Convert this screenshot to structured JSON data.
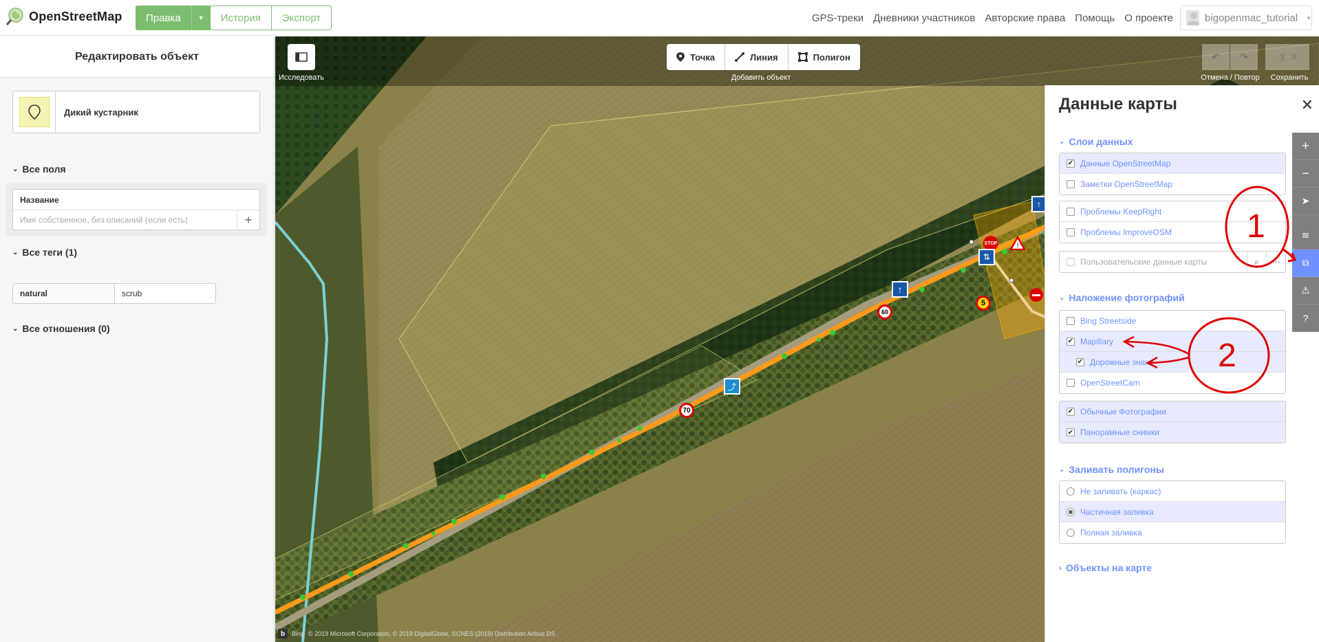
{
  "header": {
    "logo_text": "OpenStreetMap",
    "edit_label": "Правка",
    "history_label": "История",
    "export_label": "Экспорт",
    "nav": [
      "GPS-треки",
      "Дневники участников",
      "Авторские права",
      "Помощь",
      "О проекте"
    ],
    "username": "bigopenmac_tutorial"
  },
  "sidebar": {
    "title": "Редактировать объект",
    "preset_name": "Дикий кустарник",
    "all_fields_title": "Все поля",
    "name_field_label": "Название",
    "name_field_placeholder": "Имя собственное, без описаний (если есть)",
    "all_tags_title": "Все теги (1)",
    "tags": [
      {
        "key": "natural",
        "value": "scrub"
      }
    ],
    "all_relations_title": "Все отношения (0)"
  },
  "toolbar": {
    "explore_label": "Исследовать",
    "add_point": "Точка",
    "add_line": "Линия",
    "add_area": "Полигон",
    "add_label": "Добавить объект",
    "undo_redo_label": "Отмена / Повтор",
    "save_label": "Сохранить",
    "save_count": "0"
  },
  "attribution": {
    "bing": "Bing",
    "text": "© 2019 Microsoft Corporation, © 2019 DigitalGlobe, ©CNES (2019) Distribution Airbus DS"
  },
  "map_data_panel": {
    "title": "Данные карты",
    "data_layers_title": "Слои данных",
    "data_layers": [
      {
        "label": "Данные OpenStreetMap",
        "checked": true,
        "active": true
      },
      {
        "label": "Заметки OpenStreetMap",
        "checked": false,
        "active": false
      }
    ],
    "issue_layers": [
      {
        "label": "Проблемы KeepRight",
        "checked": false
      },
      {
        "label": "Проблемы ImproveOSM",
        "checked": false
      }
    ],
    "custom_data_label": "Пользовательские данные карты",
    "photo_overlays_title": "Наложение фотографий",
    "photo_overlays": [
      {
        "label": "Bing Streetside",
        "checked": false,
        "active": false,
        "indent": false
      },
      {
        "label": "Mapillary",
        "checked": true,
        "active": true,
        "indent": false
      },
      {
        "label": "Дорожные знаки",
        "checked": true,
        "active": true,
        "indent": true
      },
      {
        "label": "OpenStreetCam",
        "checked": false,
        "active": false,
        "indent": false
      }
    ],
    "photo_types": [
      {
        "label": "Обычные Фотографии",
        "checked": true
      },
      {
        "label": "Панорамные снимки",
        "checked": true
      }
    ],
    "fill_title": "Заливать полигоны",
    "fill_options": [
      {
        "label": "Не заливать (каркас)",
        "selected": false
      },
      {
        "label": "Частичная заливка",
        "selected": true
      },
      {
        "label": "Полная заливка",
        "selected": false
      }
    ],
    "map_features_title": "Объекты на карте"
  },
  "map_signs": {
    "speed_70": "70",
    "speed_60": "60",
    "speed_5": "5",
    "stop": "STOP"
  },
  "annotations": {
    "marker_1": "1",
    "marker_2": "2"
  },
  "colors": {
    "osm_green": "#7ebc6f",
    "ideditor_blue": "#7092ff",
    "road_orange": "#ff9a1a",
    "annotation_red": "#dd0000"
  }
}
